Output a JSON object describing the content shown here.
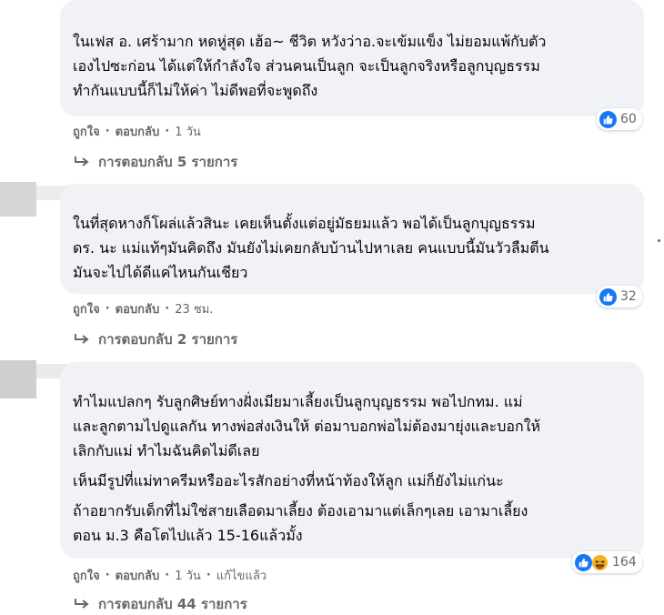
{
  "comments": [
    {
      "lines": [
        "ในเฟส อ. เศร้ามาก หดหู่สุด เฮ้อ~ ชีวิต หวังว่าอ.จะเข้มแข็ง ไม่ยอมแพ้กับตัว",
        "เองไปซะก่อน ได้แต่ให้กำลังใจ ส่วนคนเป็นลูก จะเป็นลูกจริงหรือลูกบุญธรรม",
        "ทำกันแบบนี้ก็ไม่ให้ค่า ไม่ดีพอที่จะพูดถึง"
      ],
      "reaction_count": "60",
      "like_label": "ถูกใจ",
      "reply_label": "ตอบกลับ",
      "time": "1 วัน",
      "replies_label": "การตอบกลับ 5 รายการ"
    },
    {
      "lines": [
        "ในที่สุดหางก็โผล่แล้วสินะ เคยเห็นตั้งแต่อยู่มัธยมแล้ว พอได้เป็นลูกบุญธรรม",
        "ดร. นะ แม่แท้ๆมันคิดถึง มันยังไม่เคยกลับบ้านไปหาเลย คนแบบนี้มันวัวลืมตีน",
        "มันจะไปได้ดีแค่ไหนกันเชียว"
      ],
      "reaction_count": "32",
      "like_label": "ถูกใจ",
      "reply_label": "ตอบกลับ",
      "time": "23 ชม.",
      "replies_label": "การตอบกลับ 2 รายการ"
    },
    {
      "para1": [
        "ทำไมแปลกๆ รับลูกศิษย์ทางฝั่งเมียมาเลี้ยงเป็นลูกบุญธรรม พอไปกทม. แม่",
        "และลูกตามไปดูแลกัน ทางพ่อส่งเงินให้ ต่อมาบอกพ่อไม่ต้องมายุ่งและบอกให้",
        "เลิกกับแม่ ทำไมฉันคิดไม่ดีเลย"
      ],
      "para2": "เห็นมีรูปที่แม่ทาครีมหรืออะไรสักอย่างที่หน้าท้องให้ลูก แม่ก็ยังไม่แก่นะ",
      "para3": [
        "ถ้าอยากรับเด็กที่ไม่ใช่สายเลือดมาเลี้ยง ต้องเอามาแต่เล็กๆเลย เอามาเลี้ยง",
        "ตอน ม.3 คือโตไปแล้ว 15-16แล้วมั้ง"
      ],
      "reaction_count": "164",
      "like_label": "ถูกใจ",
      "reply_label": "ตอบกลับ",
      "time": "1 วัน",
      "edited_label": "แก้ไขแล้ว",
      "replies_label": "การตอบกลับ 44 รายการ"
    }
  ],
  "colors": {
    "bubble": "#f0f2f5",
    "meta": "#65676b",
    "like": "#1877f2",
    "haha": "#f7b125"
  }
}
